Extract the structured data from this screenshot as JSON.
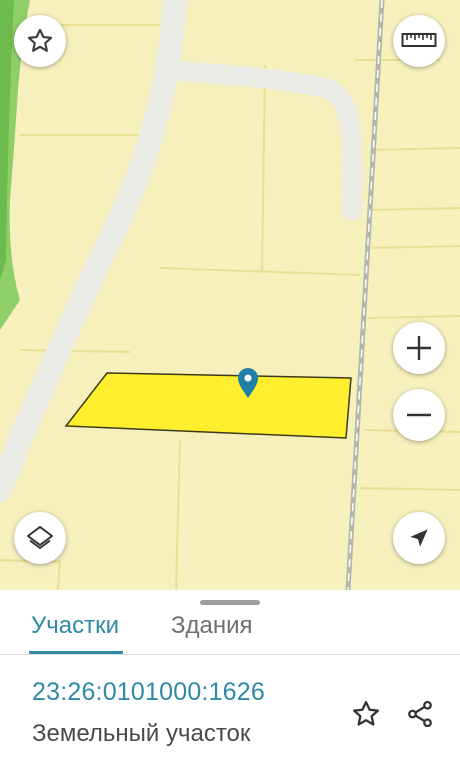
{
  "map": {
    "colors": {
      "land": "#f6f0bd",
      "parcel_line": "#ece39a",
      "road": "#efefe9",
      "forest": "#8fcf6a",
      "selected_fill": "#ffef2e",
      "pin": "#1e7fa8"
    },
    "controls": {
      "favorite_icon": "star-outline-icon",
      "ruler_icon": "ruler-icon",
      "zoom_in_icon": "plus-icon",
      "zoom_out_icon": "minus-icon",
      "layers_icon": "layers-icon",
      "locate_icon": "navigation-arrow-icon"
    }
  },
  "sheet": {
    "tabs": [
      {
        "label": "Участки",
        "active": true
      },
      {
        "label": "Здания",
        "active": false
      }
    ],
    "parcel": {
      "cadastral_number": "23:26:0101000:1626",
      "type": "Земельный участок"
    },
    "actions": {
      "favorite_icon": "star-outline-icon",
      "share_icon": "share-icon"
    },
    "accent_color": "#2f8aa6"
  }
}
